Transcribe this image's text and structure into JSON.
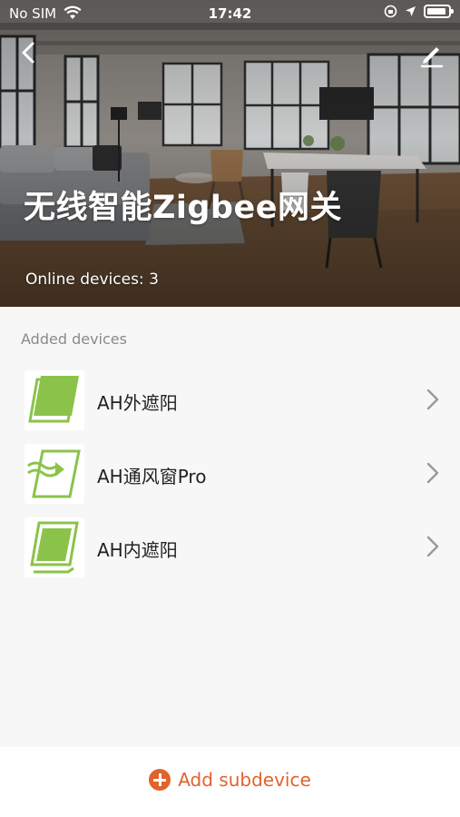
{
  "status_bar": {
    "carrier": "No SIM",
    "time": "17:42"
  },
  "header": {
    "title": "无线智能Zigbee网关",
    "online_text": "Online devices: 3",
    "back_icon": "chevron-left-icon",
    "edit_icon": "pencil-icon"
  },
  "section": {
    "label": "Added devices"
  },
  "devices": [
    {
      "name": "AH外遮阳",
      "icon": "outer-sunshade-icon"
    },
    {
      "name": "AH通风窗Pro",
      "icon": "ventilation-window-icon"
    },
    {
      "name": "AH内遮阳",
      "icon": "inner-sunshade-icon"
    }
  ],
  "footer": {
    "add_label": "Add subdevice",
    "accent": "#e2622b"
  },
  "colors": {
    "device_green": "#8bc34a",
    "background": "#f7f7f7"
  }
}
